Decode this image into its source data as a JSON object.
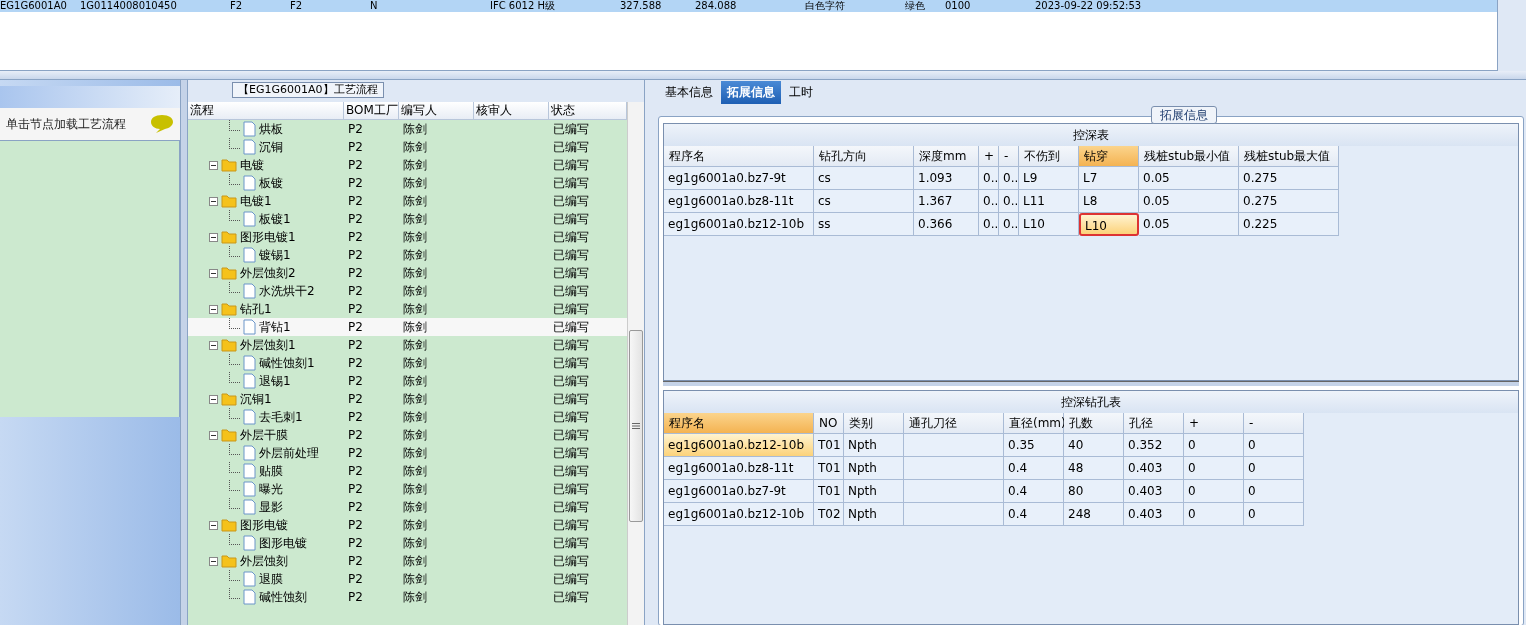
{
  "top_grid": {
    "rows": [
      {
        "selected": true,
        "cells": [
          "EG1G6001A0",
          "1G0114008010450",
          "F2",
          "F2",
          "N",
          "IFC 6012 H级",
          "327.588",
          "284.088",
          "白色字符",
          "绿色",
          "0100",
          "2023-09-22 09:52:53"
        ]
      }
    ]
  },
  "left_panel": {
    "hint": "单击节点加载工艺流程"
  },
  "flow_panel": {
    "title": "【EG1G6001A0】工艺流程",
    "columns": [
      "流程",
      "BOM工厂",
      "编写人",
      "核审人",
      "状态"
    ],
    "tree": [
      {
        "children": [
          {
            "name": "烘板",
            "factory": "P2",
            "writer": "陈剑",
            "status": "已编写",
            "selected": false
          },
          {
            "name": "沉铜",
            "factory": "P2",
            "writer": "陈剑",
            "status": "已编写",
            "selected": false
          }
        ]
      },
      {
        "name": "电镀",
        "factory": "P2",
        "writer": "陈剑",
        "status": "已编写",
        "selected": false,
        "expanded": true,
        "children": [
          {
            "name": "板镀",
            "factory": "P2",
            "writer": "陈剑",
            "status": "已编写",
            "selected": false
          }
        ]
      },
      {
        "name": "电镀1",
        "factory": "P2",
        "writer": "陈剑",
        "status": "已编写",
        "selected": false,
        "expanded": true,
        "children": [
          {
            "name": "板镀1",
            "factory": "P2",
            "writer": "陈剑",
            "status": "已编写",
            "selected": false
          }
        ]
      },
      {
        "name": "图形电镀1",
        "factory": "P2",
        "writer": "陈剑",
        "status": "已编写",
        "selected": false,
        "expanded": true,
        "children": [
          {
            "name": "镀锡1",
            "factory": "P2",
            "writer": "陈剑",
            "status": "已编写",
            "selected": false
          }
        ]
      },
      {
        "name": "外层蚀刻2",
        "factory": "P2",
        "writer": "陈剑",
        "status": "已编写",
        "selected": false,
        "expanded": true,
        "children": [
          {
            "name": "水洗烘干2",
            "factory": "P2",
            "writer": "陈剑",
            "status": "已编写",
            "selected": false
          }
        ]
      },
      {
        "name": "钻孔1",
        "factory": "P2",
        "writer": "陈剑",
        "status": "已编写",
        "selected": false,
        "expanded": true,
        "children": [
          {
            "name": "背钻1",
            "factory": "P2",
            "writer": "陈剑",
            "status": "已编写",
            "selected": true
          }
        ]
      },
      {
        "name": "外层蚀刻1",
        "factory": "P2",
        "writer": "陈剑",
        "status": "已编写",
        "selected": false,
        "expanded": true,
        "children": [
          {
            "name": "碱性蚀刻1",
            "factory": "P2",
            "writer": "陈剑",
            "status": "已编写",
            "selected": false
          },
          {
            "name": "退锡1",
            "factory": "P2",
            "writer": "陈剑",
            "status": "已编写",
            "selected": false
          }
        ]
      },
      {
        "name": "沉铜1",
        "factory": "P2",
        "writer": "陈剑",
        "status": "已编写",
        "selected": false,
        "expanded": true,
        "children": [
          {
            "name": "去毛刺1",
            "factory": "P2",
            "writer": "陈剑",
            "status": "已编写",
            "selected": false
          }
        ]
      },
      {
        "name": "外层干膜",
        "factory": "P2",
        "writer": "陈剑",
        "status": "已编写",
        "selected": false,
        "expanded": true,
        "children": [
          {
            "name": "外层前处理",
            "factory": "P2",
            "writer": "陈剑",
            "status": "已编写",
            "selected": false
          },
          {
            "name": "贴膜",
            "factory": "P2",
            "writer": "陈剑",
            "status": "已编写",
            "selected": false
          },
          {
            "name": "曝光",
            "factory": "P2",
            "writer": "陈剑",
            "status": "已编写",
            "selected": false
          },
          {
            "name": "显影",
            "factory": "P2",
            "writer": "陈剑",
            "status": "已编写",
            "selected": false
          }
        ]
      },
      {
        "name": "图形电镀",
        "factory": "P2",
        "writer": "陈剑",
        "status": "已编写",
        "selected": false,
        "expanded": true,
        "children": [
          {
            "name": "图形电镀",
            "factory": "P2",
            "writer": "陈剑",
            "status": "已编写",
            "selected": false
          }
        ]
      },
      {
        "name": "外层蚀刻",
        "factory": "P2",
        "writer": "陈剑",
        "status": "已编写",
        "selected": false,
        "expanded": true,
        "children": [
          {
            "name": "退膜",
            "factory": "P2",
            "writer": "陈剑",
            "status": "已编写",
            "selected": false
          },
          {
            "name": "碱性蚀刻",
            "factory": "P2",
            "writer": "陈剑",
            "status": "已编写",
            "selected": false
          }
        ]
      }
    ]
  },
  "tabs": [
    {
      "label": "基本信息",
      "selected": false
    },
    {
      "label": "拓展信息",
      "selected": true
    },
    {
      "label": "工时",
      "selected": false
    }
  ],
  "ext_group": {
    "title": "拓展信息"
  },
  "depth_table": {
    "title": "控深表",
    "columns": [
      {
        "label": "程序名",
        "selected": false
      },
      {
        "label": "钻孔方向",
        "selected": false
      },
      {
        "label": "深度mm",
        "selected": false
      },
      {
        "label": "+",
        "selected": false
      },
      {
        "label": "-",
        "selected": false
      },
      {
        "label": "不伤到",
        "selected": false
      },
      {
        "label": "钻穿",
        "selected": true
      },
      {
        "label": "残桩stub最小值",
        "selected": false
      },
      {
        "label": "残桩stub最大值",
        "selected": false
      }
    ],
    "rows": [
      {
        "selected": false,
        "cells": [
          "eg1g6001a0.bz7-9t",
          "cs",
          "1.093",
          "0..",
          "0..",
          "L9",
          "L7",
          "0.05",
          "0.275"
        ]
      },
      {
        "selected": false,
        "cells": [
          "eg1g6001a0.bz8-11t",
          "cs",
          "1.367",
          "0..",
          "0..",
          "L11",
          "L8",
          "0.05",
          "0.275"
        ]
      },
      {
        "selected": true,
        "cells": [
          "eg1g6001a0.bz12-10b",
          "ss",
          "0.366",
          "0..",
          "0..",
          "L10",
          "L10",
          "0.05",
          "0.225"
        ]
      }
    ]
  },
  "drill_table": {
    "title": "控深钻孔表",
    "columns": [
      {
        "label": "程序名",
        "selected": true
      },
      {
        "label": "NO",
        "selected": false
      },
      {
        "label": "类别",
        "selected": false
      },
      {
        "label": "通孔刀径",
        "selected": false
      },
      {
        "label": "直径(mm)",
        "selected": false
      },
      {
        "label": "孔数",
        "selected": false
      },
      {
        "label": "孔径",
        "selected": false
      },
      {
        "label": "+",
        "selected": false
      },
      {
        "label": "-",
        "selected": false
      }
    ],
    "rows": [
      {
        "selected": true,
        "cells": [
          "eg1g6001a0.bz12-10b",
          "T01",
          "Npth",
          "",
          "0.35",
          "40",
          "0.352",
          "0",
          "0"
        ]
      },
      {
        "selected": false,
        "cells": [
          "eg1g6001a0.bz8-11t",
          "T01",
          "Npth",
          "",
          "0.4",
          "48",
          "0.403",
          "0",
          "0"
        ]
      },
      {
        "selected": false,
        "cells": [
          "eg1g6001a0.bz7-9t",
          "T01",
          "Npth",
          "",
          "0.4",
          "80",
          "0.403",
          "0",
          "0"
        ]
      },
      {
        "selected": false,
        "cells": [
          "eg1g6001a0.bz12-10b",
          "T02",
          "Npth",
          "",
          "0.4",
          "248",
          "0.403",
          "0",
          "0"
        ]
      }
    ]
  }
}
